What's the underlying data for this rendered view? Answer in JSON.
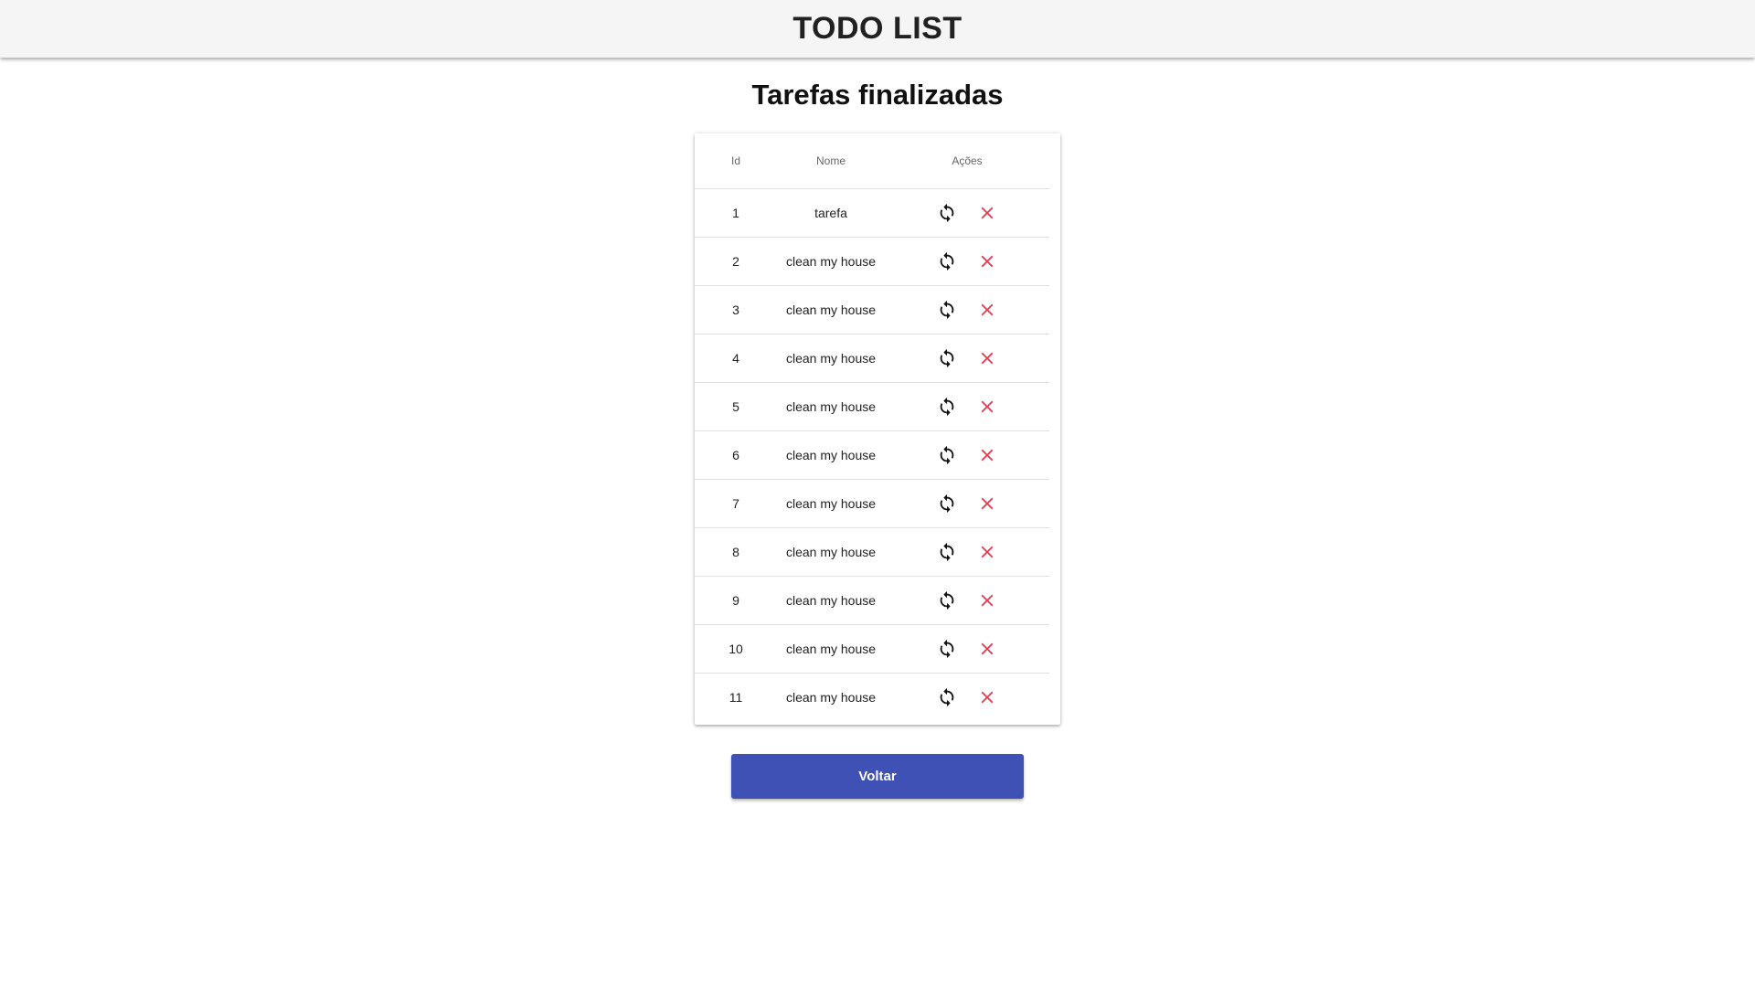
{
  "header": {
    "title": "TODO LIST",
    "background_color": "#f5f5f5"
  },
  "page": {
    "title": "Tarefas finalizadas"
  },
  "table": {
    "columns": [
      "Id",
      "Nome",
      "Ações"
    ],
    "rows": [
      {
        "id": "1",
        "name": "tarefa"
      },
      {
        "id": "2",
        "name": "clean my house"
      },
      {
        "id": "3",
        "name": "clean my house"
      },
      {
        "id": "4",
        "name": "clean my house"
      },
      {
        "id": "5",
        "name": "clean my house"
      },
      {
        "id": "6",
        "name": "clean my house"
      },
      {
        "id": "7",
        "name": "clean my house"
      },
      {
        "id": "8",
        "name": "clean my house"
      },
      {
        "id": "9",
        "name": "clean my house"
      },
      {
        "id": "10",
        "name": "clean my house"
      },
      {
        "id": "11",
        "name": "clean my house"
      }
    ],
    "row_actions": [
      {
        "icon": "restore-icon",
        "color": "#111111"
      },
      {
        "icon": "close-icon",
        "color": "#e53950"
      }
    ]
  },
  "footer": {
    "back_label": "Voltar",
    "button_color": "#3f51b5"
  }
}
